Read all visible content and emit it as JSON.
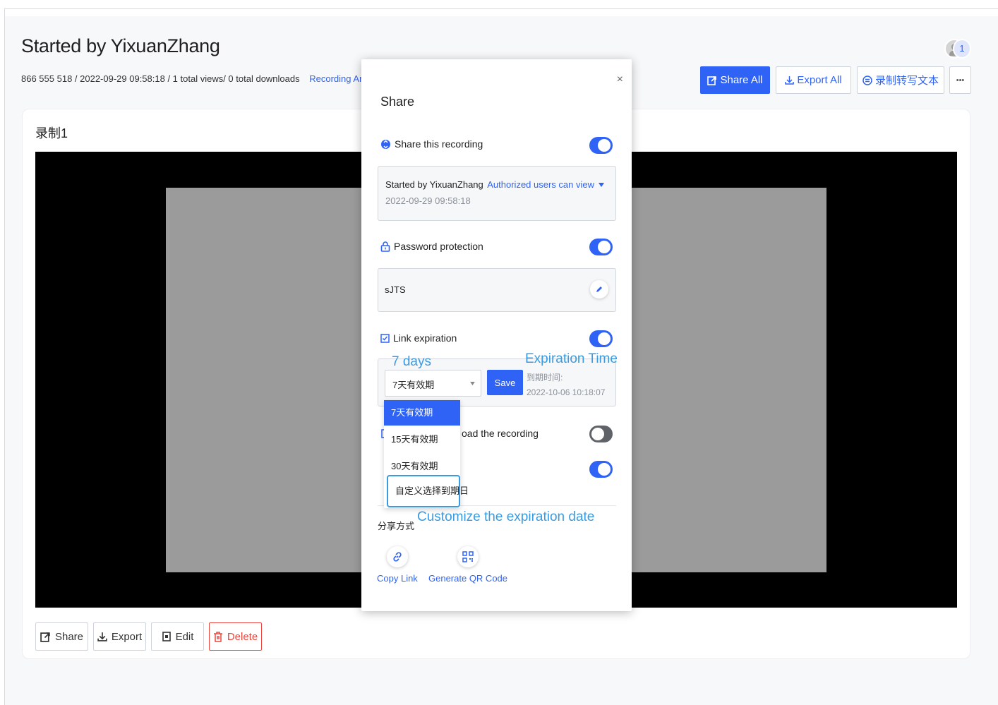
{
  "page": {
    "title": "Started by YixuanZhang",
    "meta": "866 555 518  / 2022-09-29 09:58:18  / 1 total views/ 0 total downloads",
    "analytics_link": "Recording Analytic",
    "avatar_count": "1"
  },
  "toolbar": {
    "share_all": "Share All",
    "export_all": "Export All",
    "transcribe": "录制转写文本",
    "more": "•••"
  },
  "recording": {
    "title": "录制1"
  },
  "actions": {
    "share": "Share",
    "export": "Export",
    "edit": "Edit",
    "delete": "Delete"
  },
  "dialog": {
    "close": "×",
    "title": "Share",
    "share_recording": {
      "label": "Share this recording",
      "enabled": true,
      "owner": "Started by YixuanZhang",
      "date": "2022-09-29 09:58:18",
      "permission": "Authorized users can view"
    },
    "password": {
      "label": "Password protection",
      "enabled": true,
      "value": "sJTS"
    },
    "expiration": {
      "label": "Link expiration",
      "enabled": true,
      "selected": "7天有效期",
      "save": "Save",
      "time_label": "到期时间:",
      "time_value": "2022-10-06 10:18:07",
      "options": [
        "7天有效期",
        "15天有效期",
        "30天有效期",
        "自定义选择到期日"
      ]
    },
    "download": {
      "label_partial": "oad the recording",
      "enabled": false
    },
    "fifth_toggle": {
      "enabled": true
    },
    "share_method": {
      "label": "分享方式",
      "copy_link": "Copy Link",
      "qr_code": "Generate QR Code"
    }
  },
  "annotations": {
    "seven_days": "7 days",
    "expiration_time": "Expiration Time",
    "customize": "Customize the expiration date"
  },
  "colors": {
    "primary": "#2f63f5",
    "danger": "#e8483f",
    "annotation": "#3a9be0"
  }
}
